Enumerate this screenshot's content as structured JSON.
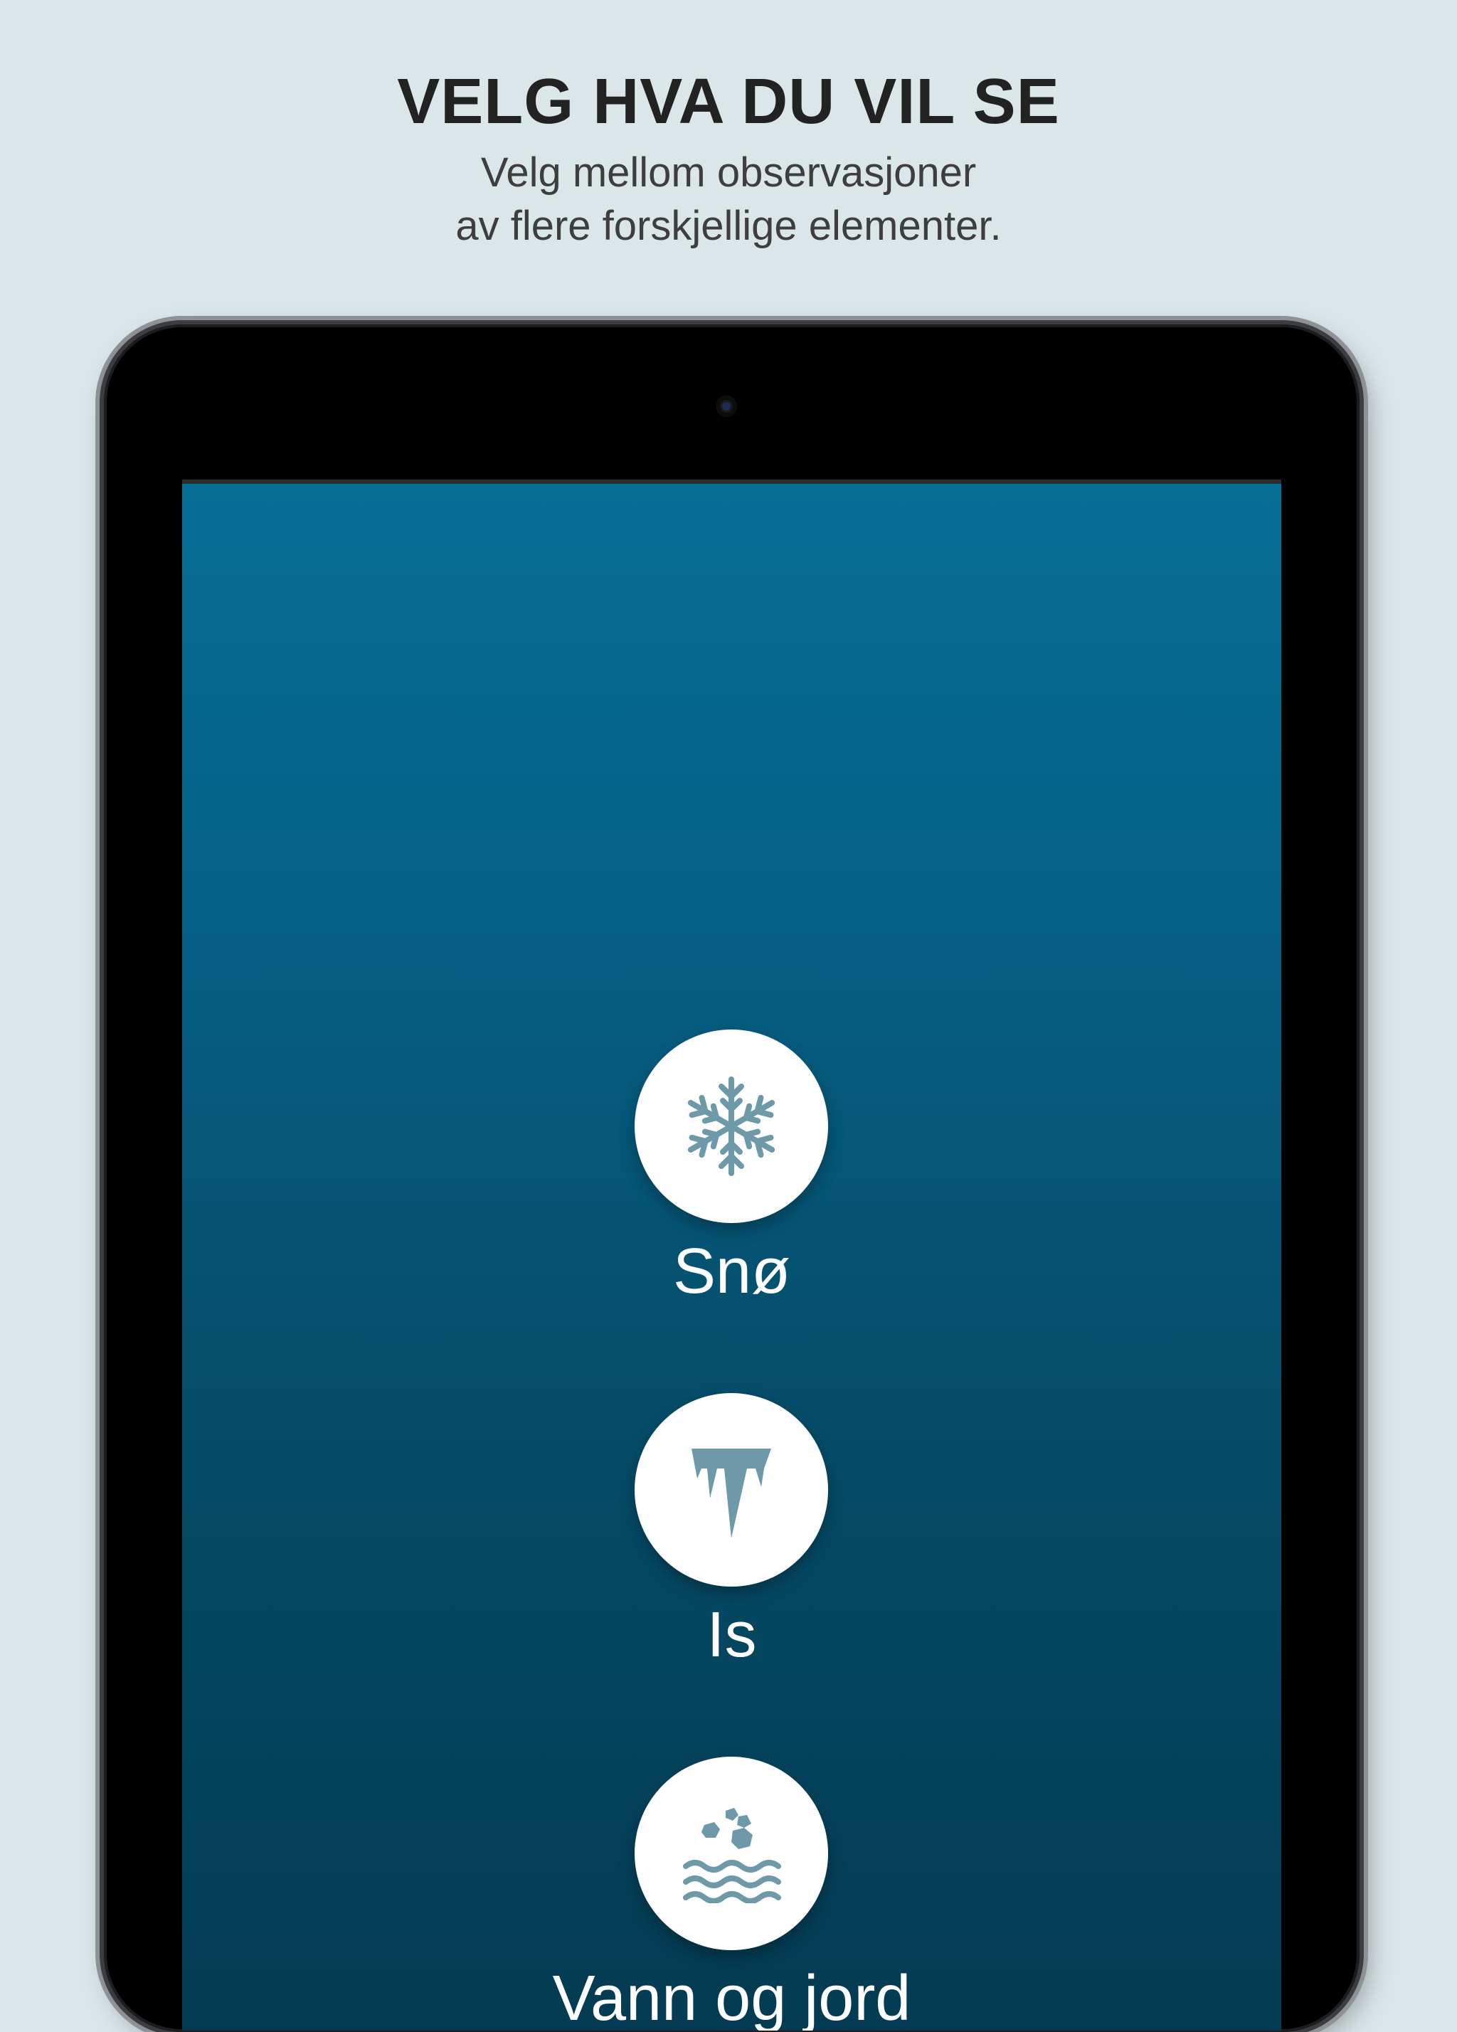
{
  "promo": {
    "headline": "VELG HVA DU VIL SE",
    "subline_1": "Velg mellom observasjoner",
    "subline_2": "av flere forskjellige elementer."
  },
  "screen": {
    "options": [
      {
        "label": "Snø",
        "icon": "snowflake-icon"
      },
      {
        "label": "Is",
        "icon": "icicle-icon"
      },
      {
        "label": "Vann og jord",
        "icon": "water-and-soil-icon"
      }
    ]
  },
  "colors": {
    "background": "#dbe6e8",
    "screen_top": "#076e95",
    "screen_bottom": "#043b52",
    "icon": "#6d99a8",
    "circle": "#ffffff",
    "label": "#ffffff"
  }
}
